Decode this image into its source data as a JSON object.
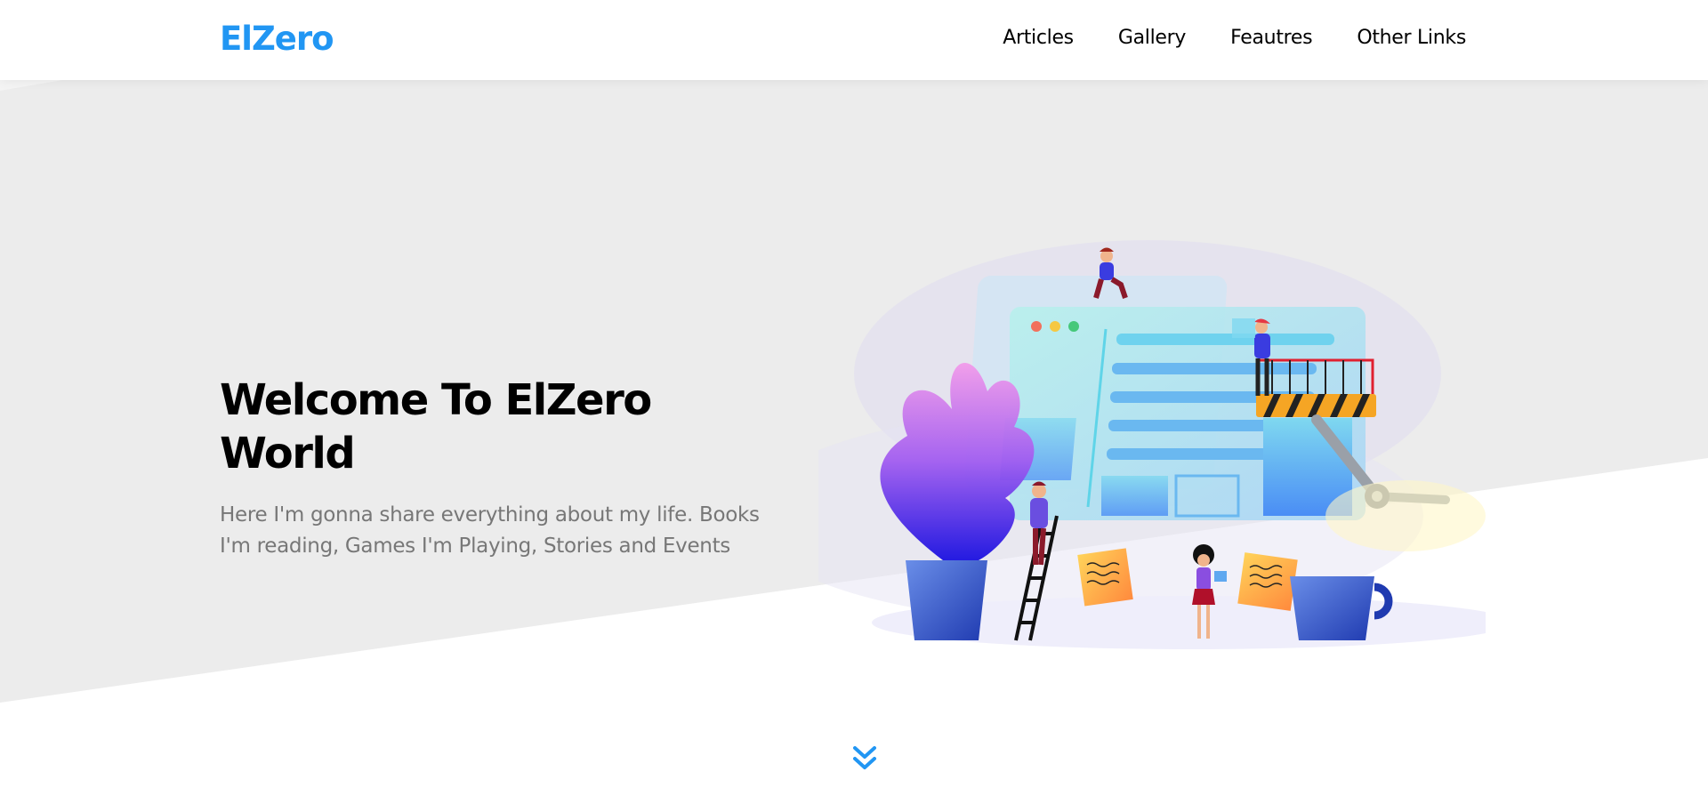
{
  "header": {
    "logo": "ElZero",
    "nav": [
      {
        "label": "Articles"
      },
      {
        "label": "Gallery"
      },
      {
        "label": "Feautres"
      },
      {
        "label": "Other Links"
      }
    ]
  },
  "hero": {
    "title": "Welcome To ElZero World",
    "description": "Here I'm gonna share everything about my life. Books I'm reading, Games I'm Playing, Stories and Events"
  },
  "icons": {
    "go_down": "double-chevron-down-icon"
  },
  "colors": {
    "accent": "#2196f3",
    "hero_background": "#ececec"
  }
}
